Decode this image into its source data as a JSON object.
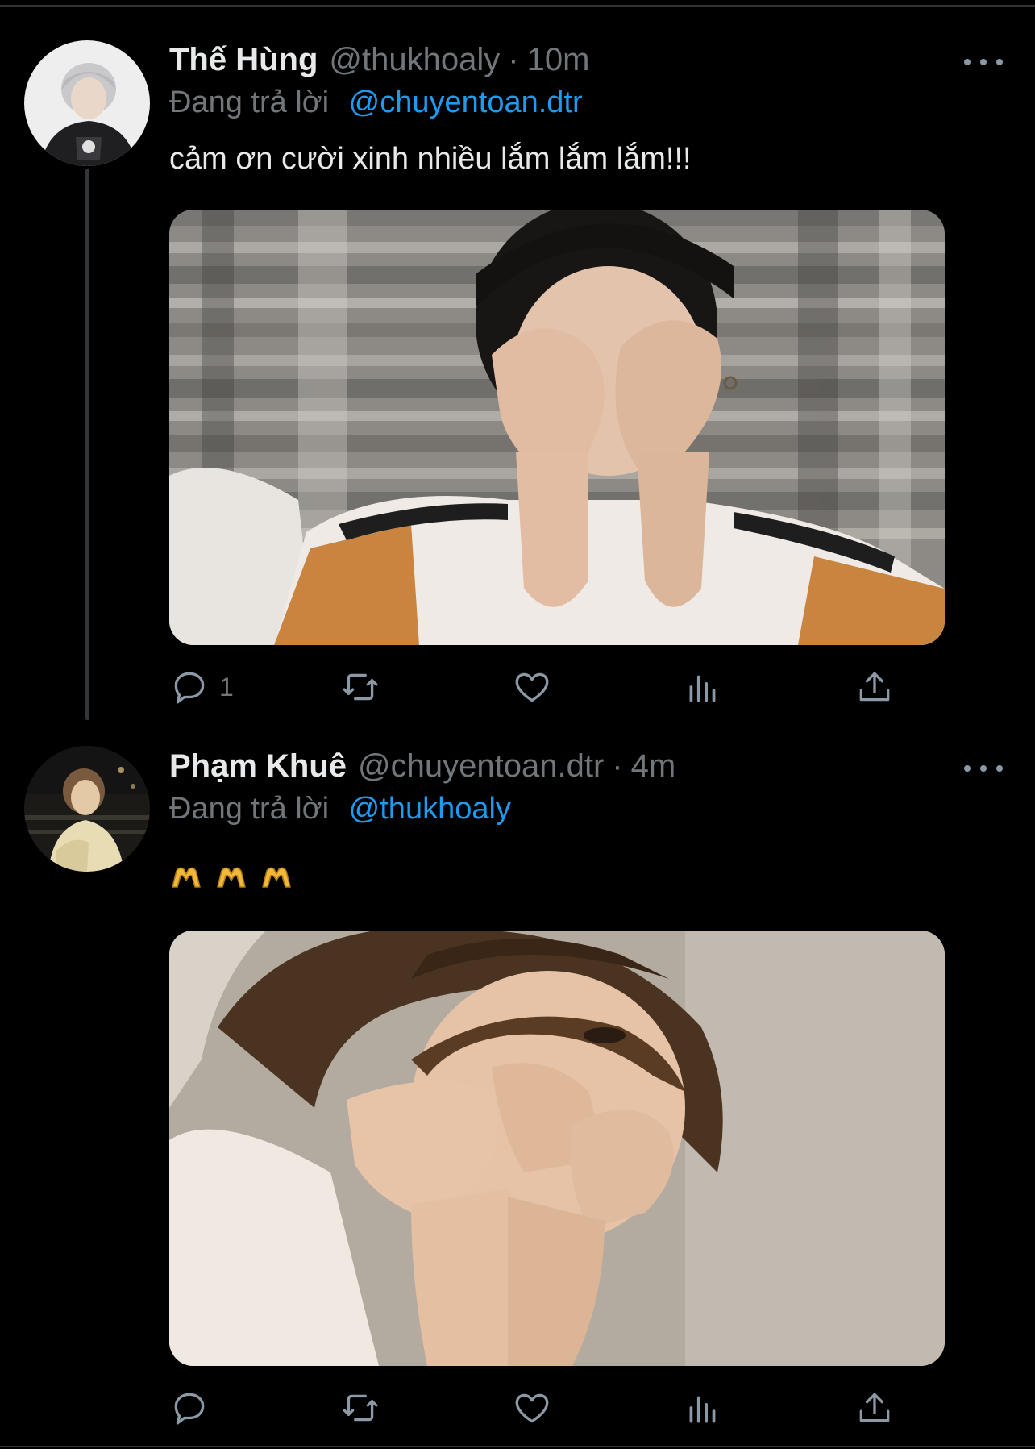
{
  "tweets": [
    {
      "display_name": "Thế Hùng",
      "handle": "@thukhoaly",
      "time": "10m",
      "reply_prefix": "Đang trả lời",
      "reply_to": "@chuyentoan.dtr",
      "text": "cảm ơn cười xinh nhiều lắm lắm lắm!!!",
      "avatar_icon": "avatar-photo",
      "media_description_icon": "photo",
      "actions": {
        "reply_count": "1",
        "retweet_count": "",
        "like_count": ""
      }
    },
    {
      "display_name": "Phạm Khuê",
      "handle": "@chuyentoan.dtr",
      "time": "4m",
      "reply_prefix": "Đang trả lời",
      "reply_to": "@thukhoaly",
      "emoji_count": 3,
      "emoji_icon": "heart-hands-emoji",
      "avatar_icon": "avatar-photo",
      "actions": {
        "reply_count": "",
        "retweet_count": "",
        "like_count": ""
      }
    }
  ],
  "colors": {
    "background": "#000000",
    "primary_text": "#e7e9ea",
    "secondary_text": "#71767b",
    "link": "#1d9bf0",
    "icon": "#8b98a5",
    "divider": "#2f3336"
  },
  "separator": "·"
}
